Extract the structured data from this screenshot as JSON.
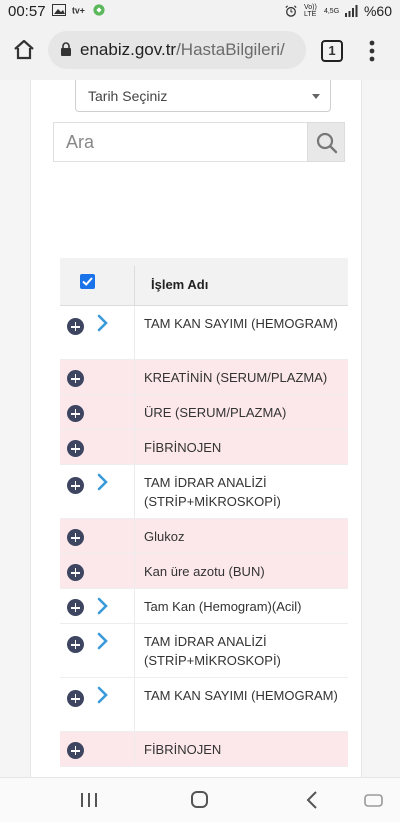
{
  "status_bar": {
    "time": "00:57",
    "network_label": "Vo)) LTE",
    "network_gen": "4,5G",
    "battery": "%60"
  },
  "browser": {
    "url_host": "enabiz.gov.tr",
    "url_path": "/HastaBilgileri/",
    "tab_count": "1"
  },
  "filters": {
    "date_select_label": "Tarih Seçiniz",
    "search_placeholder": "Ara"
  },
  "table": {
    "header": "İşlem Adı",
    "rows": [
      {
        "name": "TAM KAN SAYIMI (HEMOGRAM)",
        "expandable": true,
        "color": "white"
      },
      {
        "name": "KREATİNİN (SERUM/PLAZMA)",
        "expandable": false,
        "color": "pink"
      },
      {
        "name": "ÜRE (SERUM/PLAZMA)",
        "expandable": false,
        "color": "pink"
      },
      {
        "name": "FİBRİNOJEN",
        "expandable": false,
        "color": "pink"
      },
      {
        "name": "TAM İDRAR ANALİZİ (STRİP+MİKROSKOPİ)",
        "expandable": true,
        "color": "white"
      },
      {
        "name": "Glukoz",
        "expandable": false,
        "color": "pink"
      },
      {
        "name": "Kan üre azotu (BUN)",
        "expandable": false,
        "color": "pink"
      },
      {
        "name": "Tam Kan (Hemogram)(Acil)",
        "expandable": true,
        "color": "white"
      },
      {
        "name": "TAM İDRAR ANALİZİ (STRİP+MİKROSKOPİ)",
        "expandable": true,
        "color": "white"
      },
      {
        "name": "TAM KAN SAYIMI (HEMOGRAM)",
        "expandable": true,
        "color": "white"
      },
      {
        "name": "FİBRİNOJEN",
        "expandable": false,
        "color": "pink"
      }
    ]
  },
  "colors": {
    "row_pink": "#fce8ea",
    "plus_icon": "#3d4560",
    "chevron": "#3a9ad9",
    "checkbox": "#1a73e8"
  }
}
